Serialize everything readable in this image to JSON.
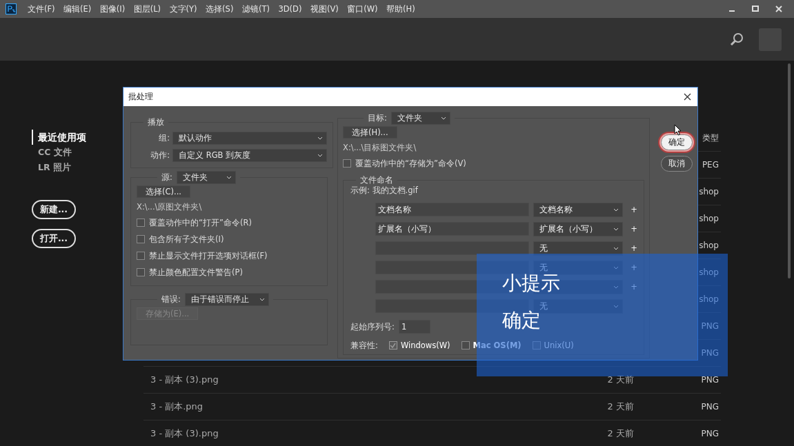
{
  "menu": [
    "文件(F)",
    "编辑(E)",
    "图像(I)",
    "图层(L)",
    "文字(Y)",
    "选择(S)",
    "滤镜(T)",
    "3D(D)",
    "视图(V)",
    "窗口(W)",
    "帮助(H)"
  ],
  "sidebar": {
    "items": [
      {
        "label": "最近使用项",
        "selected": true
      },
      {
        "label": "CC 文件",
        "selected": false
      },
      {
        "label": "LR 照片",
        "selected": false
      }
    ],
    "buttons": [
      "新建...",
      "打开..."
    ]
  },
  "file_list": {
    "type_heading": "类型",
    "rows": [
      {
        "type": "PEG"
      },
      {
        "type": "shop"
      },
      {
        "type": "shop"
      },
      {
        "type": "shop"
      },
      {
        "type": "shop"
      },
      {
        "type": "shop"
      },
      {
        "type": "PNG"
      },
      {
        "type": "PNG"
      },
      {
        "name": "3 - 副本 (3).png",
        "date": "2 天前",
        "type": "PNG"
      },
      {
        "name": "3 - 副本.png",
        "date": "2 天前",
        "type": "PNG"
      },
      {
        "name": "3 - 副本 (3).png",
        "date": "2 天前",
        "type": "PNG"
      }
    ]
  },
  "dialog": {
    "title": "批处理",
    "play": {
      "legend": "播放",
      "rows": [
        {
          "label": "组:",
          "value": "默认动作"
        },
        {
          "label": "动作:",
          "value": "自定义 RGB 到灰度"
        }
      ]
    },
    "source": {
      "label": "源:",
      "value": "文件夹",
      "button": "选择(C)...",
      "path": "X:\\...\\原图文件夹\\",
      "options": [
        {
          "label": "覆盖动作中的“打开”命令(R)",
          "checked": false
        },
        {
          "label": "包含所有子文件夹(I)",
          "checked": false
        },
        {
          "label": "禁止显示文件打开选项对话框(F)",
          "checked": false
        },
        {
          "label": "禁止颜色配置文件警告(P)",
          "checked": false
        }
      ]
    },
    "errors": {
      "label": "错误:",
      "value": "由于错误而停止",
      "button": "存储为(E)...",
      "button_disabled": true
    },
    "destination": {
      "label": "目标:",
      "value": "文件夹",
      "button": "选择(H)...",
      "path": "X:\\...\\目标图文件夹\\",
      "override": {
        "label": "覆盖动作中的“存储为”命令(V)",
        "checked": false
      }
    },
    "naming": {
      "legend": "文件命名",
      "example": "示例: 我的文档.gif",
      "rows": [
        {
          "field": "文档名称",
          "choice": "文档名称",
          "add": "+"
        },
        {
          "field": "扩展名（小写）",
          "choice": "扩展名（小写）",
          "add": "+"
        },
        {
          "choice": "无",
          "add": "+"
        },
        {
          "choice": "无",
          "add": "+"
        },
        {
          "add": "+"
        },
        {
          "choice": "无"
        }
      ],
      "serial_label": "起始序列号:",
      "serial": "1",
      "compat_label": "兼容性:",
      "compat": [
        {
          "label": "Windows(W)",
          "checked": true,
          "disabled": true
        },
        {
          "label": "Mac OS(M)",
          "checked": false,
          "disabled": false
        },
        {
          "label": "Unix(U)",
          "checked": false,
          "disabled": true
        }
      ]
    },
    "buttons": [
      {
        "label": "确定",
        "highlighted": true
      },
      {
        "label": "取消",
        "highlighted": false
      }
    ]
  },
  "tip": {
    "title": "小提示",
    "text": "确定"
  }
}
